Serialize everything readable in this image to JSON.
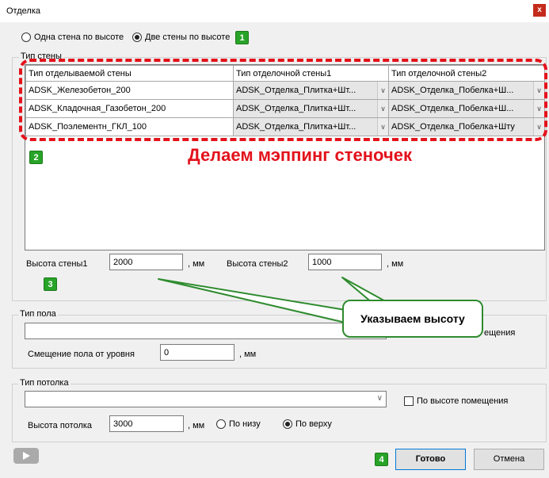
{
  "window": {
    "title": "Отделка",
    "close_label": "x"
  },
  "mode": {
    "option1": "Одна стена по высоте",
    "option2": "Две стены по высоте",
    "selected": "option2"
  },
  "wall_group": {
    "label": "Тип стены",
    "columns": [
      "Тип отделываемой стены",
      "Тип отделочной стены1",
      "Тип отделочной стены2"
    ],
    "rows": [
      [
        "ADSK_Железобетон_200",
        "ADSK_Отделка_Плитка+Шт...",
        "ADSK_Отделка_Побелка+Ш..."
      ],
      [
        "ADSK_Кладочная_Газобетон_200",
        "ADSK_Отделка_Плитка+Шт...",
        "ADSK_Отделка_Побелка+Ш..."
      ],
      [
        "ADSK_Поэлементн_ГКЛ_100",
        "ADSK_Отделка_Плитка+Шт...",
        "ADSK_Отделка_Побелка+Шту"
      ]
    ],
    "height1_label": "Высота стены1",
    "height1_value": "2000",
    "height2_label": "Высота стены2",
    "height2_value": "1000",
    "unit": ", мм"
  },
  "floor_group": {
    "label": "Тип пола",
    "type_value": "",
    "room_height_partial": "ещения",
    "offset_label": "Смещение пола от уровня",
    "offset_value": "0",
    "unit": ", мм"
  },
  "ceiling_group": {
    "label": "Тип потолка",
    "type_value": "",
    "by_room_height": "По высоте помещения",
    "height_label": "Высота потолка",
    "height_value": "3000",
    "unit": ", мм",
    "bottom_label": "По низу",
    "top_label": "По верху",
    "selected": "top"
  },
  "buttons": {
    "ok": "Готово",
    "cancel": "Отмена"
  },
  "annotations": {
    "badge1": "1",
    "badge2": "2",
    "badge3": "3",
    "badge4": "4",
    "mapping_caption": "Делаем мэппинг стеночек",
    "height_callout": "Указываем высоту",
    "accent_color": "#e3121b",
    "badge_color": "#27a327"
  },
  "icons": {
    "play": "play-icon",
    "dropdown": "chevron-down-icon"
  }
}
